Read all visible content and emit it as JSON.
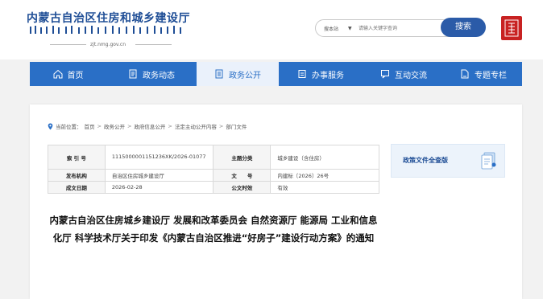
{
  "header": {
    "site_title": "内蒙古自治区住房和城乡建设厅",
    "domain": "zjt.nmg.gov.cn"
  },
  "search": {
    "scope": "搜本站",
    "placeholder": "请输入关键字查询",
    "button_label": "搜索"
  },
  "nav": {
    "items": [
      {
        "label": "首页",
        "icon": "home-icon"
      },
      {
        "label": "政务动态",
        "icon": "news-icon"
      },
      {
        "label": "政务公开",
        "icon": "document-icon",
        "active": true
      },
      {
        "label": "办事服务",
        "icon": "service-icon"
      },
      {
        "label": "互动交流",
        "icon": "chat-icon"
      },
      {
        "label": "专题专栏",
        "icon": "topic-icon"
      }
    ]
  },
  "breadcrumb": {
    "prefix": "当前位置：",
    "items": [
      "首页",
      "政务公开",
      "政府信息公开",
      "法定主动公开内容",
      "部门文件"
    ]
  },
  "meta": {
    "index_label": "索 引 号",
    "index_value": "1115000001151236XK/2026-01077",
    "category_label": "主题分类",
    "category_value": "城乡建设（含住房）",
    "issuer_label": "发布机构",
    "issuer_value": "自治区住房城乡建设厅",
    "docno_label": "文　　号",
    "docno_value": "内建标〔2026〕26号",
    "date_label": "成文日期",
    "date_value": "2026-02-28",
    "validity_label": "公文时效",
    "validity_value": "有效"
  },
  "sidebar": {
    "banner_label": "政策文件全查版"
  },
  "document": {
    "title": "内蒙古自治区住房城乡建设厅 发展和改革委员会 自然资源厅 能源局 工业和信息化厅 科学技术厅关于印发《内蒙古自治区推进“好房子”建设行动方案》的通知"
  },
  "colors": {
    "brand_blue": "#2a6fc6",
    "title_blue": "#1f4e96",
    "seal_red": "#c82222"
  }
}
